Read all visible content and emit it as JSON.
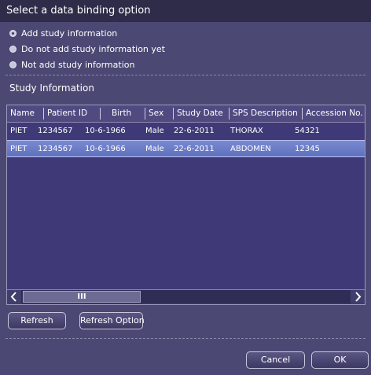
{
  "dialog": {
    "title": "Select a data binding option"
  },
  "options": [
    {
      "label": "Add study information",
      "checked": true
    },
    {
      "label": "Do not add study information yet",
      "checked": false
    },
    {
      "label": "Not add study information",
      "checked": false
    }
  ],
  "study_section": {
    "title": "Study Information"
  },
  "table": {
    "columns": [
      "Name",
      "Patient ID",
      "Birth",
      "Sex",
      "Study Date",
      "SPS Description",
      "Accession No."
    ],
    "rows": [
      {
        "name": "PIET",
        "patient_id": "1234567",
        "birth": "10-6-1966",
        "sex": "Male",
        "study_date": "22-6-2011",
        "sps_description": "THORAX",
        "accession_no": "54321",
        "selected": false
      },
      {
        "name": "PIET",
        "patient_id": "1234567",
        "birth": "10-6-1966",
        "sex": "Male",
        "study_date": "22-6-2011",
        "sps_description": "ABDOMEN",
        "accession_no": "12345",
        "selected": true
      }
    ]
  },
  "scrollbar": {
    "left_icon": "chevron-left-icon",
    "right_icon": "chevron-right-icon",
    "grip": "III"
  },
  "buttons": {
    "refresh": "Refresh",
    "refresh_option": "Refresh Option",
    "cancel": "Cancel",
    "ok": "OK"
  },
  "colors": {
    "background": "#4b4873",
    "title_bar": "#2e2c49",
    "table_background": "#3f3a77",
    "selected_row": "#6a7bc6"
  }
}
